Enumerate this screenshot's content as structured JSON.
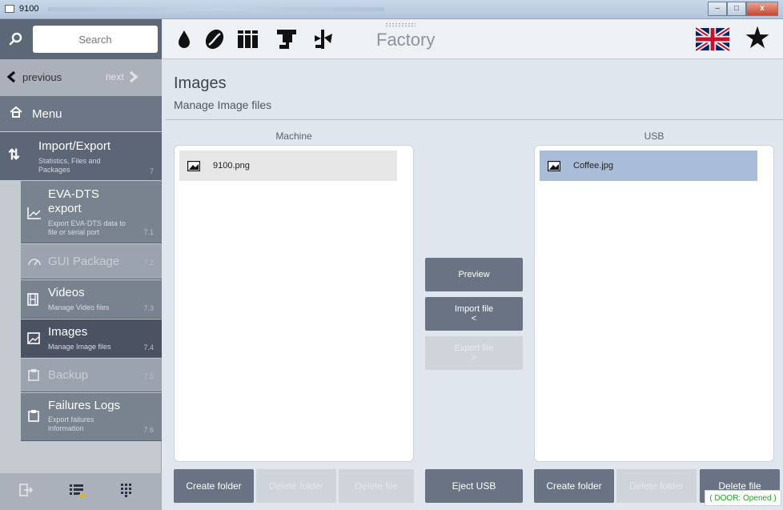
{
  "window": {
    "title": "9100"
  },
  "search": {
    "placeholder": "Search"
  },
  "nav": {
    "previous": "previous",
    "next": "next"
  },
  "menu": {
    "label": "Menu"
  },
  "section": {
    "title": "Import/Export",
    "subtitle": "Statistics, Files and Packages",
    "number": "7"
  },
  "sub_items": [
    {
      "title": "EVA-DTS export",
      "subtitle": "Export EVA-DTS data to file or serial port",
      "number": "7.1"
    },
    {
      "title": "GUI Package",
      "number": "7.2"
    },
    {
      "title": "Videos",
      "subtitle": "Manage Video files",
      "number": "7.3"
    },
    {
      "title": "Images",
      "subtitle": "Manage Image files",
      "number": "7.4"
    },
    {
      "title": "Backup",
      "number": "7.5"
    },
    {
      "title": "Failures Logs",
      "subtitle": "Export failures information",
      "number": "7.6"
    }
  ],
  "toolbar": {
    "mode": "Factory"
  },
  "page": {
    "title": "Images",
    "subtitle": "Manage Image files"
  },
  "machine": {
    "header": "Machine",
    "files": [
      "9100.png"
    ]
  },
  "usb": {
    "header": "USB",
    "files": [
      "Coffee.jpg"
    ]
  },
  "actions": {
    "preview": "Preview",
    "import": "Import file",
    "import_arrow": "<",
    "export": "Export file",
    "export_arrow": ">",
    "eject": "Eject USB"
  },
  "bottom": {
    "create_folder": "Create folder",
    "delete_folder": "Delete folder",
    "delete_file": "Delete file"
  },
  "status": {
    "door": "( DOOR: Opened )"
  }
}
